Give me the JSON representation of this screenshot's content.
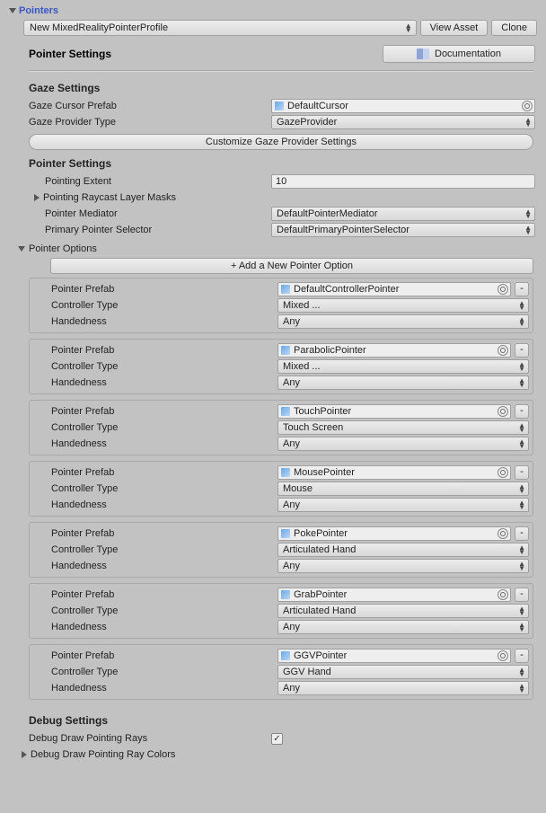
{
  "header": {
    "title": "Pointers"
  },
  "profile": {
    "name": "New MixedRealityPointerProfile",
    "view_asset": "View Asset",
    "clone": "Clone"
  },
  "settings": {
    "title": "Pointer Settings",
    "documentation": "Documentation"
  },
  "gaze": {
    "title": "Gaze Settings",
    "cursor_label": "Gaze Cursor Prefab",
    "cursor_value": "DefaultCursor",
    "provider_label": "Gaze Provider Type",
    "provider_value": "GazeProvider",
    "customize": "Customize Gaze Provider Settings"
  },
  "ptr": {
    "title": "Pointer Settings",
    "extent_label": "Pointing Extent",
    "extent_value": "10",
    "raycast_label": "Pointing Raycast Layer Masks",
    "mediator_label": "Pointer Mediator",
    "mediator_value": "DefaultPointerMediator",
    "primary_label": "Primary Pointer Selector",
    "primary_value": "DefaultPrimaryPointerSelector"
  },
  "options": {
    "title": "Pointer Options",
    "add": "+ Add a New Pointer Option",
    "prefab_label": "Pointer Prefab",
    "controller_label": "Controller Type",
    "hand_label": "Handedness",
    "remove": "-",
    "items": [
      {
        "prefab": "DefaultControllerPointer",
        "controller": "Mixed ...",
        "hand": "Any"
      },
      {
        "prefab": "ParabolicPointer",
        "controller": "Mixed ...",
        "hand": "Any"
      },
      {
        "prefab": "TouchPointer",
        "controller": "Touch Screen",
        "hand": "Any"
      },
      {
        "prefab": "MousePointer",
        "controller": "Mouse",
        "hand": "Any"
      },
      {
        "prefab": "PokePointer",
        "controller": "Articulated Hand",
        "hand": "Any"
      },
      {
        "prefab": "GrabPointer",
        "controller": "Articulated Hand",
        "hand": "Any"
      },
      {
        "prefab": "GGVPointer",
        "controller": "GGV Hand",
        "hand": "Any"
      }
    ]
  },
  "debug": {
    "title": "Debug Settings",
    "draw_label": "Debug Draw Pointing Rays",
    "draw_value": true,
    "colors_label": "Debug Draw Pointing Ray Colors"
  }
}
